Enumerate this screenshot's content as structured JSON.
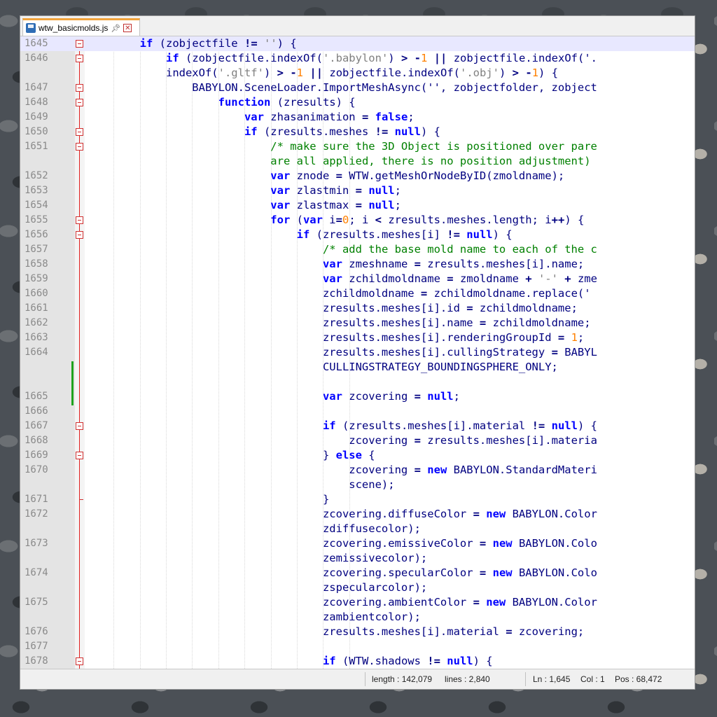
{
  "tab": {
    "file_name": "wtw_basicmolds.js"
  },
  "status": {
    "length": "length : 142,079",
    "lines": "lines : 2,840",
    "ln": "Ln : 1,645",
    "col": "Col : 1",
    "pos": "Pos : 68,472"
  },
  "colors": {
    "keyword": "#0000ff",
    "comment": "#008000",
    "number": "#ff8000",
    "string": "#808080",
    "text": "#000080"
  },
  "rows": [
    {
      "ln": "1645",
      "tokens": [
        [
          "t",
          "        "
        ],
        [
          "k",
          "if"
        ],
        [
          "t",
          " (zobjectfile "
        ],
        [
          "o",
          "!="
        ],
        [
          "t",
          " "
        ],
        [
          "s",
          "''"
        ],
        [
          "t",
          ") {"
        ]
      ],
      "fold": "box",
      "hl": true
    },
    {
      "ln": "1646",
      "tokens": [
        [
          "t",
          "            "
        ],
        [
          "k",
          "if"
        ],
        [
          "t",
          " (zobjectfile.indexOf("
        ],
        [
          "s",
          "'.babylon'"
        ],
        [
          "t",
          ") "
        ],
        [
          "o",
          ">"
        ],
        [
          "t",
          " "
        ],
        [
          "o",
          "-"
        ],
        [
          "n",
          "1"
        ],
        [
          "t",
          " "
        ],
        [
          "o",
          "||"
        ],
        [
          "t",
          " zobjectfile.indexOf('."
        ]
      ],
      "fold": "box"
    },
    {
      "ln": "",
      "tokens": [
        [
          "t",
          "            indexOf("
        ],
        [
          "s",
          "'.gltf'"
        ],
        [
          "t",
          ") "
        ],
        [
          "o",
          ">"
        ],
        [
          "t",
          " "
        ],
        [
          "o",
          "-"
        ],
        [
          "n",
          "1"
        ],
        [
          "t",
          " "
        ],
        [
          "o",
          "||"
        ],
        [
          "t",
          " zobjectfile.indexOf("
        ],
        [
          "s",
          "'.obj'"
        ],
        [
          "t",
          ") "
        ],
        [
          "o",
          ">"
        ],
        [
          "t",
          " "
        ],
        [
          "o",
          "-"
        ],
        [
          "n",
          "1"
        ],
        [
          "t",
          ") {"
        ]
      ]
    },
    {
      "ln": "1647",
      "tokens": [
        [
          "t",
          "                BABYLON.SceneLoader.ImportMeshAsync('', zobjectfolder, zobject"
        ]
      ],
      "fold": "box"
    },
    {
      "ln": "1648",
      "tokens": [
        [
          "t",
          "                    "
        ],
        [
          "k",
          "function"
        ],
        [
          "t",
          " (zresults) {"
        ]
      ],
      "fold": "box"
    },
    {
      "ln": "1649",
      "tokens": [
        [
          "t",
          "                        "
        ],
        [
          "k",
          "var"
        ],
        [
          "t",
          " zhasanimation "
        ],
        [
          "o",
          "="
        ],
        [
          "t",
          " "
        ],
        [
          "k",
          "false"
        ],
        [
          "t",
          ";"
        ]
      ]
    },
    {
      "ln": "1650",
      "tokens": [
        [
          "t",
          "                        "
        ],
        [
          "k",
          "if"
        ],
        [
          "t",
          " (zresults.meshes "
        ],
        [
          "o",
          "!="
        ],
        [
          "t",
          " "
        ],
        [
          "k",
          "null"
        ],
        [
          "t",
          ") {"
        ]
      ],
      "fold": "box"
    },
    {
      "ln": "1651",
      "tokens": [
        [
          "t",
          "                            "
        ],
        [
          "c",
          "/* make sure the 3D Object is positioned over pare"
        ]
      ],
      "fold": "box"
    },
    {
      "ln": "",
      "tokens": [
        [
          "t",
          "                            "
        ],
        [
          "c",
          "are all applied, there is no position adjustment)"
        ]
      ]
    },
    {
      "ln": "1652",
      "tokens": [
        [
          "t",
          "                            "
        ],
        [
          "k",
          "var"
        ],
        [
          "t",
          " znode "
        ],
        [
          "o",
          "="
        ],
        [
          "t",
          " WTW.getMeshOrNodeByID(zmoldname);"
        ]
      ]
    },
    {
      "ln": "1653",
      "tokens": [
        [
          "t",
          "                            "
        ],
        [
          "k",
          "var"
        ],
        [
          "t",
          " zlastmin "
        ],
        [
          "o",
          "="
        ],
        [
          "t",
          " "
        ],
        [
          "k",
          "null"
        ],
        [
          "t",
          ";"
        ]
      ]
    },
    {
      "ln": "1654",
      "tokens": [
        [
          "t",
          "                            "
        ],
        [
          "k",
          "var"
        ],
        [
          "t",
          " zlastmax "
        ],
        [
          "o",
          "="
        ],
        [
          "t",
          " "
        ],
        [
          "k",
          "null"
        ],
        [
          "t",
          ";"
        ]
      ]
    },
    {
      "ln": "1655",
      "tokens": [
        [
          "t",
          "                            "
        ],
        [
          "k",
          "for"
        ],
        [
          "t",
          " ("
        ],
        [
          "k",
          "var"
        ],
        [
          "t",
          " i"
        ],
        [
          "o",
          "="
        ],
        [
          "n",
          "0"
        ],
        [
          "t",
          "; i "
        ],
        [
          "o",
          "<"
        ],
        [
          "t",
          " zresults.meshes.length; i"
        ],
        [
          "o",
          "++"
        ],
        [
          "t",
          ") {"
        ]
      ],
      "fold": "box"
    },
    {
      "ln": "1656",
      "tokens": [
        [
          "t",
          "                                "
        ],
        [
          "k",
          "if"
        ],
        [
          "t",
          " (zresults.meshes[i] "
        ],
        [
          "o",
          "!="
        ],
        [
          "t",
          " "
        ],
        [
          "k",
          "null"
        ],
        [
          "t",
          ") {"
        ]
      ],
      "fold": "box"
    },
    {
      "ln": "1657",
      "tokens": [
        [
          "t",
          "                                    "
        ],
        [
          "c",
          "/* add the base mold name to each of the c"
        ]
      ]
    },
    {
      "ln": "1658",
      "tokens": [
        [
          "t",
          "                                    "
        ],
        [
          "k",
          "var"
        ],
        [
          "t",
          " zmeshname "
        ],
        [
          "o",
          "="
        ],
        [
          "t",
          " zresults.meshes[i].name;"
        ]
      ]
    },
    {
      "ln": "1659",
      "tokens": [
        [
          "t",
          "                                    "
        ],
        [
          "k",
          "var"
        ],
        [
          "t",
          " zchildmoldname "
        ],
        [
          "o",
          "="
        ],
        [
          "t",
          " zmoldname "
        ],
        [
          "o",
          "+"
        ],
        [
          "t",
          " "
        ],
        [
          "s",
          "'-'"
        ],
        [
          "t",
          " "
        ],
        [
          "o",
          "+"
        ],
        [
          "t",
          " zme"
        ]
      ]
    },
    {
      "ln": "1660",
      "tokens": [
        [
          "t",
          "                                    zchildmoldname "
        ],
        [
          "o",
          "="
        ],
        [
          "t",
          " zchildmoldname.replace('"
        ]
      ]
    },
    {
      "ln": "1661",
      "tokens": [
        [
          "t",
          "                                    zresults.meshes[i].id "
        ],
        [
          "o",
          "="
        ],
        [
          "t",
          " zchildmoldname;"
        ]
      ]
    },
    {
      "ln": "1662",
      "tokens": [
        [
          "t",
          "                                    zresults.meshes[i].name "
        ],
        [
          "o",
          "="
        ],
        [
          "t",
          " zchildmoldname;"
        ]
      ]
    },
    {
      "ln": "1663",
      "tokens": [
        [
          "t",
          "                                    zresults.meshes[i].renderingGroupId "
        ],
        [
          "o",
          "="
        ],
        [
          "t",
          " "
        ],
        [
          "n",
          "1"
        ],
        [
          "t",
          ";"
        ]
      ]
    },
    {
      "ln": "1664",
      "tokens": [
        [
          "t",
          "                                    zresults.meshes[i].cullingStrategy "
        ],
        [
          "o",
          "="
        ],
        [
          "t",
          " BABYL"
        ]
      ]
    },
    {
      "ln": "",
      "tokens": [
        [
          "t",
          "                                    CULLINGSTRATEGY_BOUNDINGSPHERE_ONLY;"
        ]
      ]
    },
    {
      "ln": "",
      "tokens": []
    },
    {
      "ln": "1665",
      "tokens": [
        [
          "t",
          "                                    "
        ],
        [
          "k",
          "var"
        ],
        [
          "t",
          " zcovering "
        ],
        [
          "o",
          "="
        ],
        [
          "t",
          " "
        ],
        [
          "k",
          "null"
        ],
        [
          "t",
          ";"
        ]
      ]
    },
    {
      "ln": "1666",
      "tokens": []
    },
    {
      "ln": "1667",
      "tokens": [
        [
          "t",
          "                                    "
        ],
        [
          "k",
          "if"
        ],
        [
          "t",
          " (zresults.meshes[i].material "
        ],
        [
          "o",
          "!="
        ],
        [
          "t",
          " "
        ],
        [
          "k",
          "null"
        ],
        [
          "t",
          ") {"
        ]
      ],
      "fold": "box"
    },
    {
      "ln": "1668",
      "tokens": [
        [
          "t",
          "                                        zcovering "
        ],
        [
          "o",
          "="
        ],
        [
          "t",
          " zresults.meshes[i].materia"
        ]
      ]
    },
    {
      "ln": "1669",
      "tokens": [
        [
          "t",
          "                                    } "
        ],
        [
          "k",
          "else"
        ],
        [
          "t",
          " {"
        ]
      ],
      "fold": "box"
    },
    {
      "ln": "1670",
      "tokens": [
        [
          "t",
          "                                        zcovering "
        ],
        [
          "o",
          "="
        ],
        [
          "t",
          " "
        ],
        [
          "k",
          "new"
        ],
        [
          "t",
          " BABYLON.StandardMateri"
        ]
      ]
    },
    {
      "ln": "",
      "tokens": [
        [
          "t",
          "                                        scene);"
        ]
      ]
    },
    {
      "ln": "1671",
      "tokens": [
        [
          "t",
          "                                    }"
        ]
      ],
      "fold": "end"
    },
    {
      "ln": "1672",
      "tokens": [
        [
          "t",
          "                                    zcovering.diffuseColor "
        ],
        [
          "o",
          "="
        ],
        [
          "t",
          " "
        ],
        [
          "k",
          "new"
        ],
        [
          "t",
          " BABYLON.Color"
        ]
      ]
    },
    {
      "ln": "",
      "tokens": [
        [
          "t",
          "                                    zdiffusecolor);"
        ]
      ]
    },
    {
      "ln": "1673",
      "tokens": [
        [
          "t",
          "                                    zcovering.emissiveColor "
        ],
        [
          "o",
          "="
        ],
        [
          "t",
          " "
        ],
        [
          "k",
          "new"
        ],
        [
          "t",
          " BABYLON.Colo"
        ]
      ]
    },
    {
      "ln": "",
      "tokens": [
        [
          "t",
          "                                    zemissivecolor);"
        ]
      ]
    },
    {
      "ln": "1674",
      "tokens": [
        [
          "t",
          "                                    zcovering.specularColor "
        ],
        [
          "o",
          "="
        ],
        [
          "t",
          " "
        ],
        [
          "k",
          "new"
        ],
        [
          "t",
          " BABYLON.Colo"
        ]
      ]
    },
    {
      "ln": "",
      "tokens": [
        [
          "t",
          "                                    zspecularcolor);"
        ]
      ]
    },
    {
      "ln": "1675",
      "tokens": [
        [
          "t",
          "                                    zcovering.ambientColor "
        ],
        [
          "o",
          "="
        ],
        [
          "t",
          " "
        ],
        [
          "k",
          "new"
        ],
        [
          "t",
          " BABYLON.Color"
        ]
      ]
    },
    {
      "ln": "",
      "tokens": [
        [
          "t",
          "                                    zambientcolor);"
        ]
      ]
    },
    {
      "ln": "1676",
      "tokens": [
        [
          "t",
          "                                    zresults.meshes[i].material "
        ],
        [
          "o",
          "="
        ],
        [
          "t",
          " zcovering;"
        ]
      ]
    },
    {
      "ln": "1677",
      "tokens": []
    },
    {
      "ln": "1678",
      "tokens": [
        [
          "t",
          "                                    "
        ],
        [
          "k",
          "if"
        ],
        [
          "t",
          " (WTW.shadows "
        ],
        [
          "o",
          "!="
        ],
        [
          "t",
          " "
        ],
        [
          "k",
          "null"
        ],
        [
          "t",
          ") {"
        ]
      ],
      "fold": "box"
    }
  ]
}
